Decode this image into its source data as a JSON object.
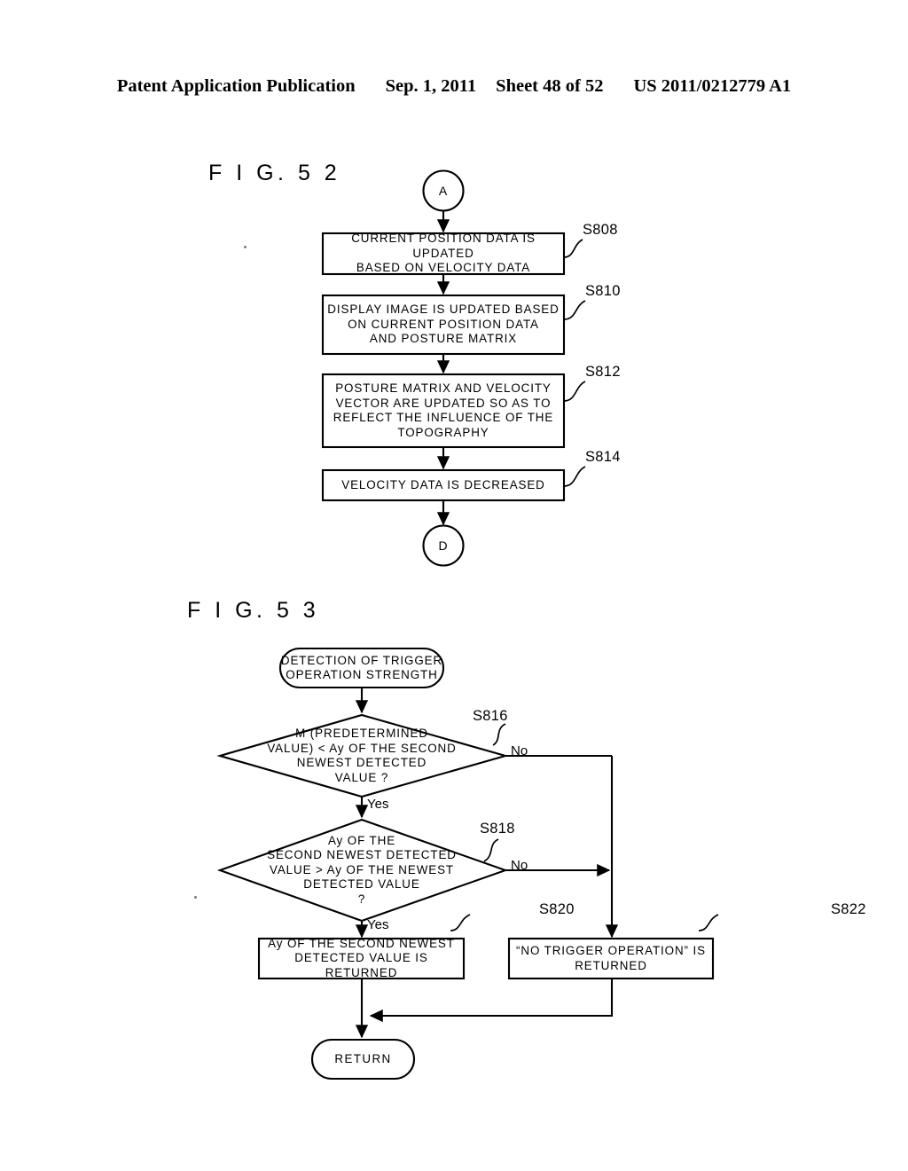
{
  "header": {
    "publication": "Patent Application Publication",
    "date": "Sep. 1, 2011",
    "sheet": "Sheet 48 of 52",
    "docnum": "US 2011/0212779 A1"
  },
  "figures": [
    {
      "id": "fig52",
      "title": "F I G.  5 2",
      "nodes": [
        {
          "key": "connector_a",
          "type": "connector-circle",
          "text": "A"
        },
        {
          "key": "s808",
          "type": "process",
          "text": "CURRENT POSITION DATA IS UPDATED\nBASED ON VELOCITY DATA",
          "step": "S808"
        },
        {
          "key": "s810",
          "type": "process",
          "text": "DISPLAY IMAGE IS UPDATED BASED\nON CURRENT POSITION DATA\nAND POSTURE MATRIX",
          "step": "S810"
        },
        {
          "key": "s812",
          "type": "process",
          "text": "POSTURE MATRIX AND VELOCITY\nVECTOR ARE UPDATED SO AS TO\nREFLECT THE INFLUENCE OF THE\nTOPOGRAPHY",
          "step": "S812"
        },
        {
          "key": "s814",
          "type": "process",
          "text": "VELOCITY DATA IS DECREASED",
          "step": "S814"
        },
        {
          "key": "connector_d",
          "type": "connector-circle",
          "text": "D"
        }
      ]
    },
    {
      "id": "fig53",
      "title": "F I G.  5 3",
      "nodes": [
        {
          "key": "start",
          "type": "terminator",
          "text": "DETECTION OF TRIGGER\nOPERATION STRENGTH"
        },
        {
          "key": "s816",
          "type": "decision",
          "text": "M (PREDETERMINED\nVALUE) < Ay OF THE SECOND\nNEWEST DETECTED\nVALUE ?",
          "step": "S816",
          "yes": "Yes",
          "no": "No"
        },
        {
          "key": "s818",
          "type": "decision",
          "text": "Ay OF THE\nSECOND NEWEST DETECTED\nVALUE > Ay OF THE NEWEST\nDETECTED VALUE\n?",
          "step": "S818",
          "yes": "Yes",
          "no": "No"
        },
        {
          "key": "s820",
          "type": "process",
          "text": "Ay OF THE SECOND NEWEST\nDETECTED VALUE IS RETURNED",
          "step": "S820"
        },
        {
          "key": "s822",
          "type": "process",
          "text": "“NO TRIGGER OPERATION” IS\nRETURNED",
          "step": "S822"
        },
        {
          "key": "return",
          "type": "terminator",
          "text": "RETURN"
        }
      ]
    }
  ]
}
